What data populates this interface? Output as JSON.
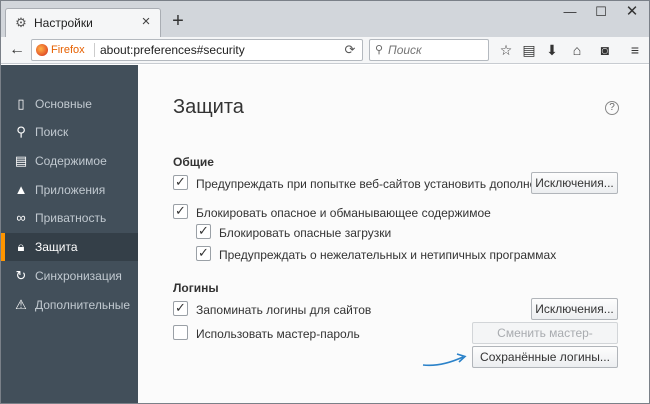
{
  "tab": {
    "title": "Настройки"
  },
  "toolbar": {
    "browser_label": "Firefox",
    "url": "about:preferences#security",
    "search_placeholder": "Поиск"
  },
  "sidebar": {
    "items": [
      {
        "label": "Основные",
        "icon": "general-icon"
      },
      {
        "label": "Поиск",
        "icon": "search-icon"
      },
      {
        "label": "Содержимое",
        "icon": "content-icon"
      },
      {
        "label": "Приложения",
        "icon": "applications-icon"
      },
      {
        "label": "Приватность",
        "icon": "privacy-mask-icon"
      },
      {
        "label": "Защита",
        "icon": "lock-icon",
        "active": true
      },
      {
        "label": "Синхронизация",
        "icon": "sync-icon"
      },
      {
        "label": "Дополнительные",
        "icon": "advanced-icon"
      }
    ]
  },
  "main": {
    "title": "Защита",
    "general": {
      "heading": "Общие",
      "warn_addons": {
        "label": "Предупреждать при попытке веб-сайтов установить дополнения",
        "checked": true
      },
      "exceptions_button": "Исключения...",
      "block_dangerous": {
        "label": "Блокировать опасное и обманывающее содержимое",
        "checked": true
      },
      "block_downloads": {
        "label": "Блокировать опасные загрузки",
        "checked": true
      },
      "warn_unwanted": {
        "label": "Предупреждать о нежелательных и нетипичных программах",
        "checked": true
      }
    },
    "logins": {
      "heading": "Логины",
      "remember": {
        "label": "Запоминать логины для сайтов",
        "checked": true
      },
      "exceptions_button": "Исключения...",
      "master_password": {
        "label": "Использовать мастер-пароль",
        "checked": false
      },
      "change_master_button": "Сменить мастер-пароль...",
      "saved_logins_button": "Сохранённые логины..."
    }
  },
  "colors": {
    "sidebar_bg": "#424f5a",
    "active_accent": "#ff9500",
    "arrow": "#2b82c9"
  }
}
